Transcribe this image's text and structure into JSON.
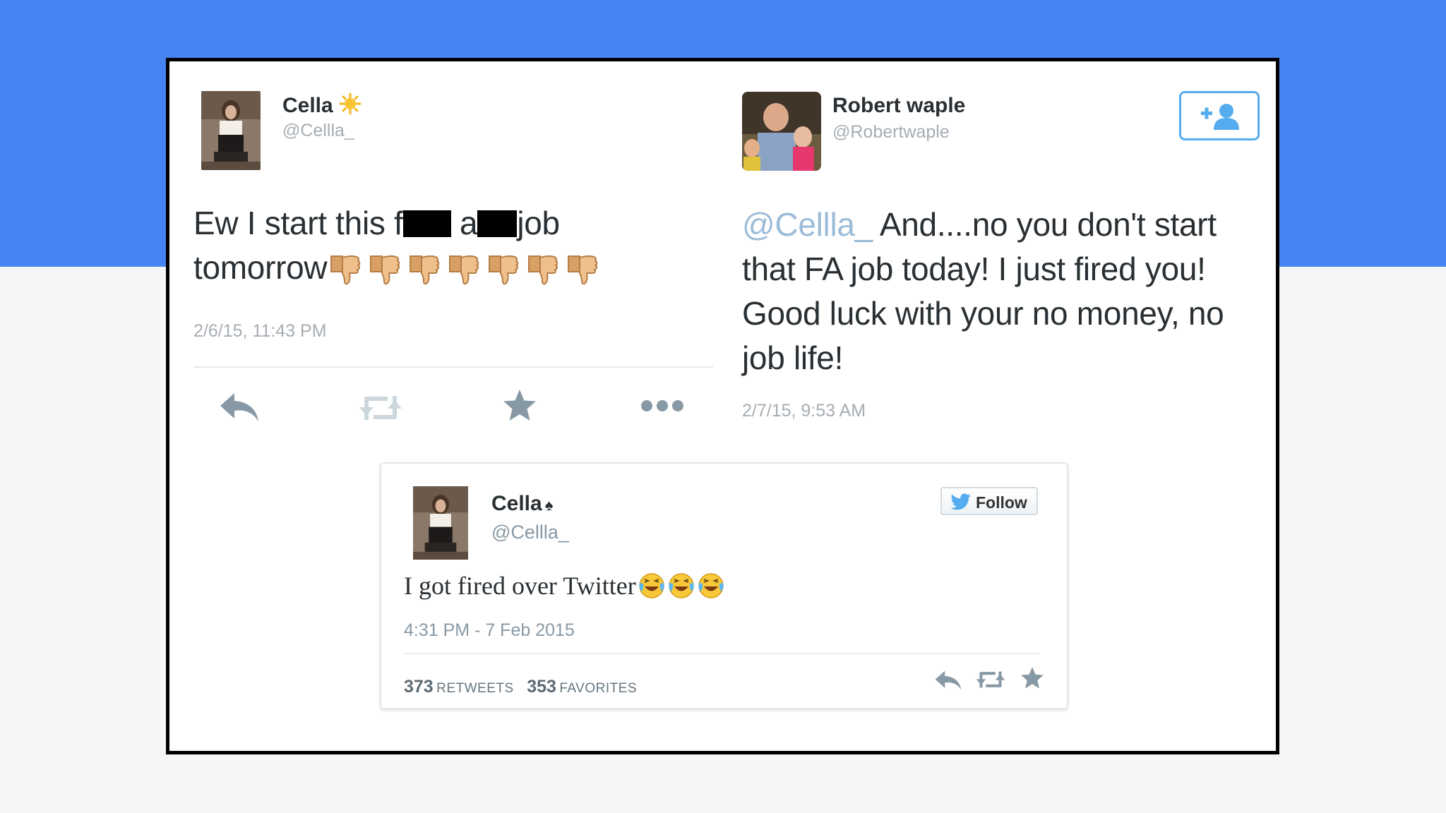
{
  "tweet_left": {
    "name": "Cella",
    "handle": "@Cellla_",
    "text_1": "Ew I start this f",
    "text_2": "a",
    "text_3": "job",
    "text_4": "tomorrow",
    "emoji_count": 7,
    "timestamp": "2/6/15, 11:43 PM"
  },
  "tweet_right": {
    "name": "Robert waple",
    "handle": "@Robertwaple",
    "mention": "@Cellla_",
    "line_1": " And....no you don't start",
    "line_2": "that FA job today!  I just fired you!",
    "line_3": "Good luck with your no money, no",
    "line_4": "job life!",
    "timestamp": "2/7/15, 9:53 AM"
  },
  "embed": {
    "name": "Cella",
    "handle": "@Cellla_",
    "follow_label": "Follow",
    "text": "I got fired over Twitter",
    "timestamp": "4:31 PM - 7 Feb 2015",
    "retweets_count": "373",
    "retweets_label": "Retweets",
    "favorites_count": "353",
    "favorites_label": "Favorites"
  },
  "colors": {
    "banner": "#4584f1",
    "twitter_blue": "#55acee",
    "text_dark": "#292f33",
    "text_gray": "#a6adb3"
  },
  "icons": [
    "sun-icon",
    "spade-icon",
    "thumbs-down-icon",
    "laughing-emoji-icon",
    "reply-icon",
    "retweet-icon",
    "favorite-icon",
    "more-icon",
    "add-user-icon",
    "twitter-bird-icon"
  ]
}
